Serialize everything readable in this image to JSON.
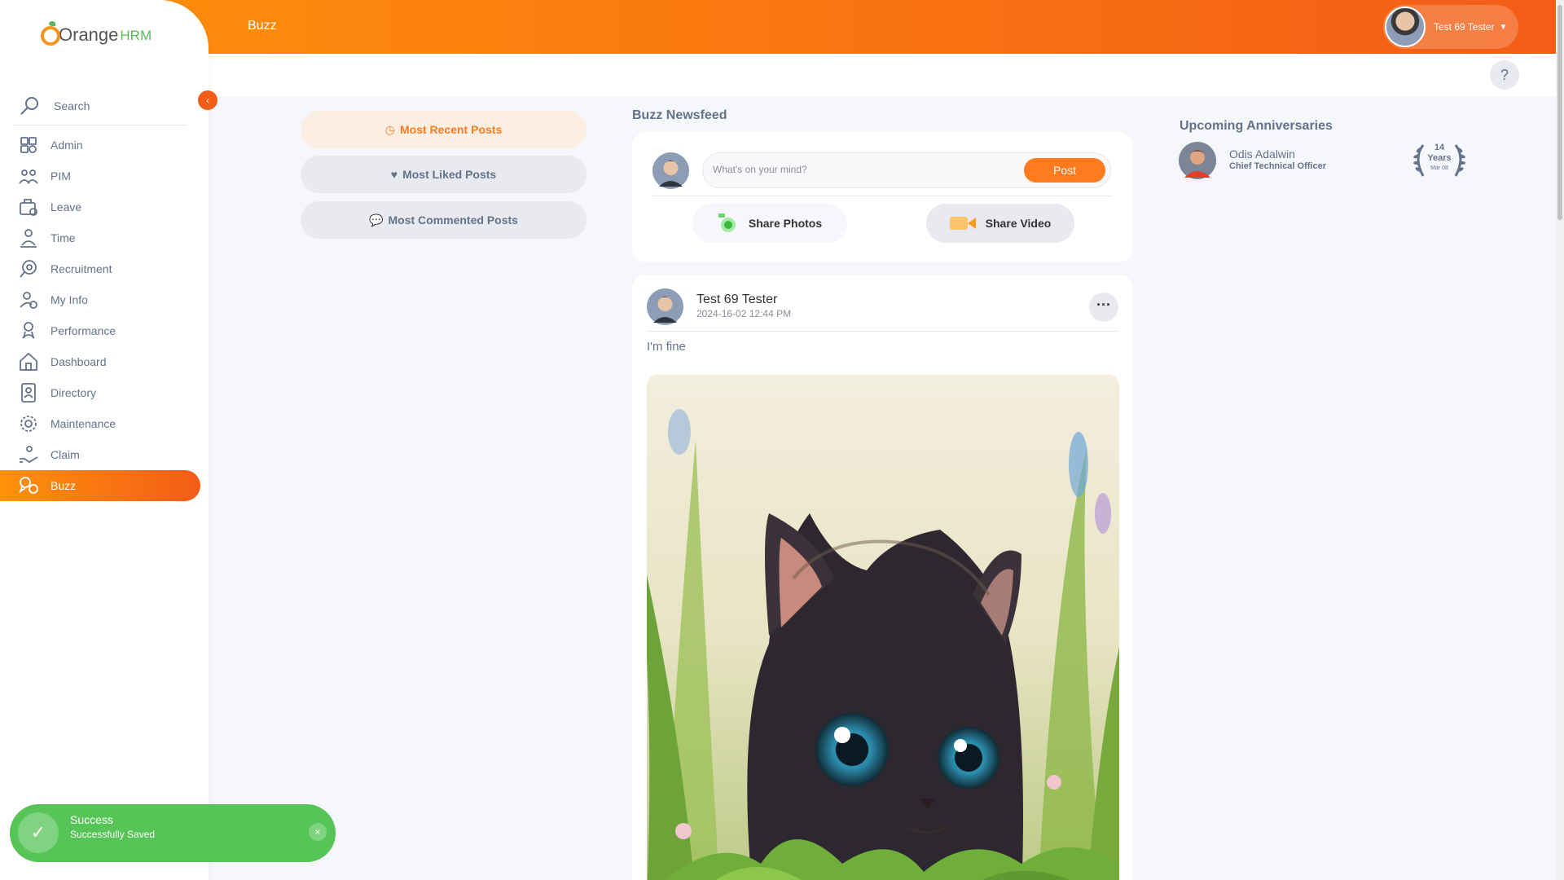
{
  "topbar": {
    "title": "Buzz",
    "user": {
      "name": "Test 69 Tester"
    }
  },
  "help": {
    "label": "?"
  },
  "brand": {
    "logo_text_1": "Orange",
    "logo_text_2": "HRM"
  },
  "sidebar": {
    "search_label": "Search",
    "items": [
      {
        "label": "Admin",
        "icon": "admin-icon"
      },
      {
        "label": "PIM",
        "icon": "pim-icon"
      },
      {
        "label": "Leave",
        "icon": "leave-icon"
      },
      {
        "label": "Time",
        "icon": "time-icon"
      },
      {
        "label": "Recruitment",
        "icon": "recruitment-icon"
      },
      {
        "label": "My Info",
        "icon": "myinfo-icon"
      },
      {
        "label": "Performance",
        "icon": "performance-icon"
      },
      {
        "label": "Dashboard",
        "icon": "dashboard-icon"
      },
      {
        "label": "Directory",
        "icon": "directory-icon"
      },
      {
        "label": "Maintenance",
        "icon": "maintenance-icon"
      },
      {
        "label": "Claim",
        "icon": "claim-icon"
      },
      {
        "label": "Buzz",
        "icon": "buzz-icon",
        "active": true
      }
    ]
  },
  "filters": {
    "recent": "Most Recent Posts",
    "liked": "Most Liked Posts",
    "commented": "Most Commented Posts"
  },
  "feed": {
    "title": "Buzz Newsfeed",
    "composer": {
      "placeholder": "What's on your mind?",
      "post_label": "Post",
      "share_photos": "Share Photos",
      "share_video": "Share Video"
    },
    "posts": [
      {
        "author": "Test 69 Tester",
        "timestamp": "2024-16-02 12:44 PM",
        "text": "I'm fine"
      }
    ]
  },
  "anniversaries": {
    "title": "Upcoming Anniversaries",
    "items": [
      {
        "name": "Odis Adalwin",
        "job": "Chief Technical Officer",
        "years_num": "14",
        "years_label": "Years",
        "date": "Mar 08"
      }
    ]
  },
  "toast": {
    "title": "Success",
    "message": "Successfully Saved",
    "close": "×"
  },
  "colors": {
    "accent_start": "#ff920b",
    "accent_end": "#f35c17",
    "toast_green": "#56c456"
  }
}
